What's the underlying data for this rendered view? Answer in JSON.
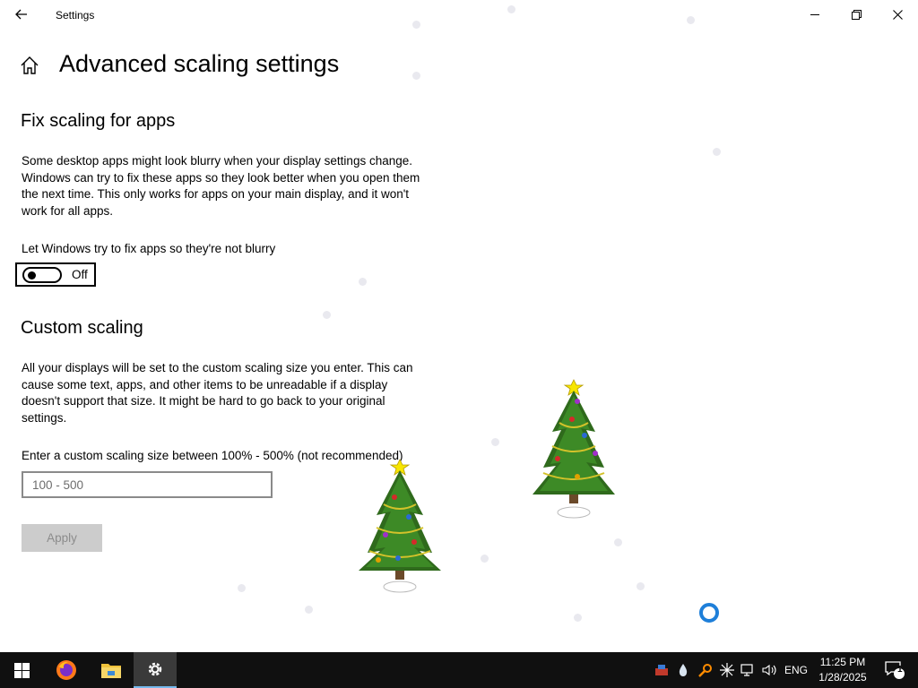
{
  "window": {
    "title": "Settings",
    "back_icon": "back-arrow-icon",
    "controls": [
      "minimize-icon",
      "restore-icon",
      "close-icon"
    ]
  },
  "page": {
    "home_icon": "home-icon",
    "title": "Advanced scaling settings"
  },
  "fix_scaling": {
    "heading": "Fix scaling for apps",
    "description": "Some desktop apps might look blurry when your display settings change. Windows can try to fix these apps so they look better when you open them the next time. This only works for apps on your main display, and it won't work for all apps.",
    "toggle_label": "Let Windows try to fix apps so they're not blurry",
    "toggle_state": "Off"
  },
  "custom_scaling": {
    "heading": "Custom scaling",
    "description": "All your displays will be set to the custom scaling size you enter. This can cause some text, apps, and other items to be unreadable if a display doesn't support that size. It might be hard to go back to your original settings.",
    "input_label": "Enter a custom scaling size between 100% - 500% (not recommended)",
    "input_placeholder": "100 - 500",
    "input_value": "",
    "apply_label": "Apply"
  },
  "taskbar": {
    "apps": [
      "windows-start-icon",
      "firefox-icon",
      "file-explorer-icon",
      "settings-gear-icon"
    ],
    "tray_icons": [
      "network-drive-icon",
      "water-drop-icon",
      "search-key-icon",
      "sparkle-icon",
      "network-icon",
      "volume-icon"
    ],
    "language": "ENG",
    "time": "11:25 PM",
    "date": "1/28/2025",
    "notifications_icon": "action-center-icon",
    "notifications_count": "1"
  },
  "colors": {
    "accent": "#76b9ed",
    "taskbar_bg": "#101010",
    "spinner": "#1e7fd9",
    "apply_disabled_bg": "#cccccc"
  }
}
